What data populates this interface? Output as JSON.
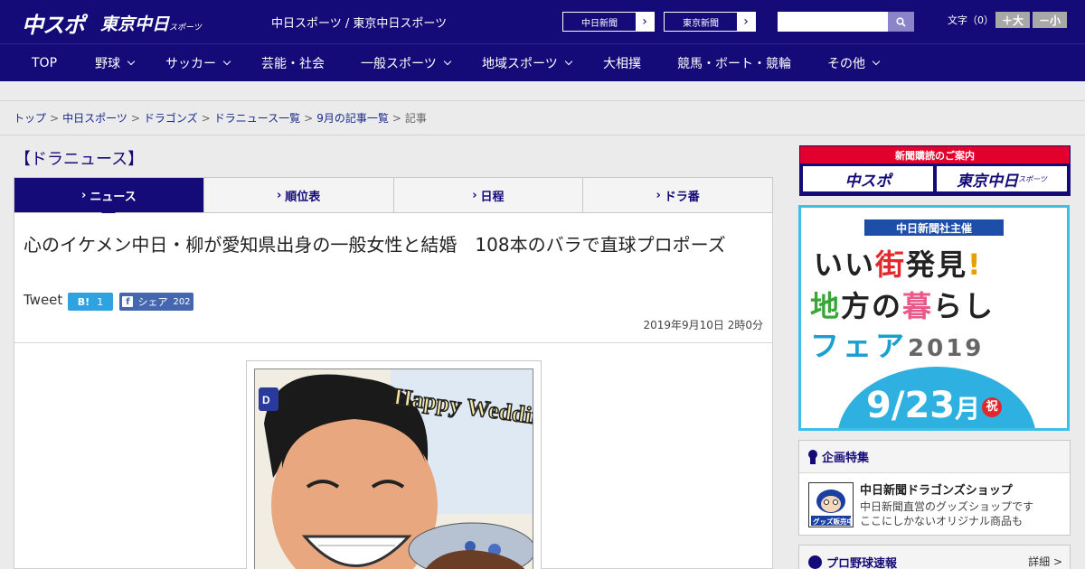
{
  "header": {
    "logo_chuspo": "中スポ",
    "logo_tokyo": "東京中日",
    "logo_tokyo_sub": "スポーツ",
    "tagline": "中日スポーツ / 東京中日スポーツ",
    "paper_links": [
      "中日新聞",
      "東京新聞"
    ],
    "search_placeholder": "",
    "font_label": "文字（0）",
    "font_bigger": "＋大",
    "font_smaller": "－小"
  },
  "nav": [
    {
      "label": "TOP",
      "has_menu": false
    },
    {
      "label": "野球",
      "has_menu": true
    },
    {
      "label": "サッカー",
      "has_menu": true
    },
    {
      "label": "芸能・社会",
      "has_menu": false
    },
    {
      "label": "一般スポーツ",
      "has_menu": true
    },
    {
      "label": "地域スポーツ",
      "has_menu": true
    },
    {
      "label": "大相撲",
      "has_menu": false
    },
    {
      "label": "競馬・ボート・競輪",
      "has_menu": false
    },
    {
      "label": "その他",
      "has_menu": true
    }
  ],
  "breadcrumb": [
    "トップ",
    "中日スポーツ",
    "ドラゴンズ",
    "ドラニュース一覧",
    "9月の記事一覧",
    "記事"
  ],
  "section_heading": "【ドラニュース】",
  "tabs": [
    {
      "label": "ニュース",
      "active": true
    },
    {
      "label": "順位表",
      "active": false
    },
    {
      "label": "日程",
      "active": false
    },
    {
      "label": "ドラ番",
      "active": false
    }
  ],
  "article": {
    "headline": "心のイケメン中日・柳が愛知県出身の一般女性と結婚　108本のバラで直球プロポーズ",
    "tweet_label": "Tweet",
    "hatena_count": "1",
    "fb_label": "シェア",
    "fb_count": "202",
    "date": "2019年9月10日 2時0分",
    "image_caption_art": "Happy Wedding"
  },
  "sidebar": {
    "subscribe_title": "新聞購読のご案内",
    "subscribe_logos": [
      "中スポ",
      "東京中日"
    ],
    "subscribe_logo_sub": "スポーツ",
    "banner": {
      "host": "中日新聞社主催",
      "line1a": "いい",
      "line1b": "街",
      "line1c": "発見",
      "line1d": "!",
      "line2a": "地",
      "line2b": "方の",
      "line2c": "暮",
      "line2d": "らし",
      "line3": "フェア",
      "year": "2019",
      "date_main": "9/23",
      "date_month_char": "月",
      "holiday": "祝"
    },
    "feature": {
      "title": "企画特集",
      "shop_title": "中日新聞ドラゴンズショップ",
      "shop_desc_1": "中日新聞直営のグッズショップです",
      "shop_desc_2": "ここにしかないオリジナル商品も",
      "thumb_label": "グッズ販売中"
    },
    "baseball": {
      "title": "プロ野球速報",
      "more": "詳細 >"
    }
  },
  "colors": {
    "brand_navy": "#140a78",
    "subscribe_red": "#e2002c",
    "banner_blue": "#3cc0e8",
    "hatena_blue": "#2fa3e0",
    "facebook_blue": "#4467b0"
  }
}
